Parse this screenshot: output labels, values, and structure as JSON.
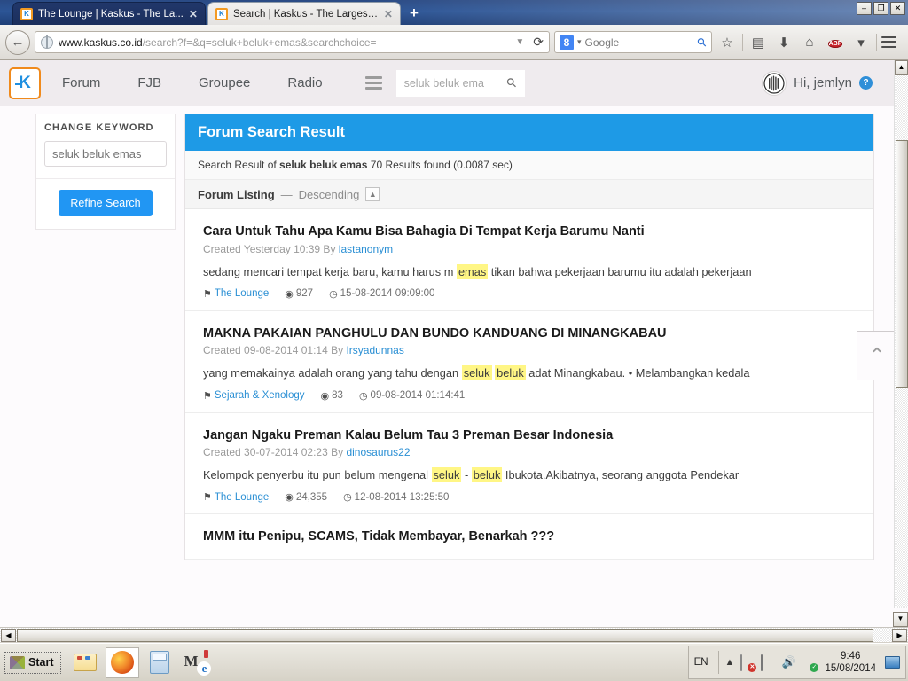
{
  "browser": {
    "tabs": [
      {
        "title": "The Lounge | Kaskus - The La...",
        "active": false,
        "favicon": "kaskus-favicon",
        "close": "✕"
      },
      {
        "title": "Search | Kaskus - The Largest...",
        "active": true,
        "favicon": "kaskus-favicon",
        "close": "✕"
      }
    ],
    "new_tab_label": "+",
    "window_controls": {
      "minimize": "–",
      "restore": "❐",
      "close": "✕"
    },
    "back_arrow": "←",
    "url_strong": "www.kaskus.co.id",
    "url_rest": "/search?f=&q=seluk+beluk+emas&searchchoice=",
    "url_dropdown": "▼",
    "reload": "⟳",
    "search_engine": "Google",
    "search_engine_glyph": "8",
    "search_caret": "▾",
    "search_magnifier": "⚲",
    "toolbar_icons": [
      "bookmark-star-icon",
      "reading-list-icon",
      "downloads-icon",
      "home-icon",
      "adblock-icon",
      "menu-icon"
    ],
    "star": "☆",
    "reading_list": "▤",
    "download": "⬇",
    "home": "⌂",
    "abp_label": "ABP",
    "abp_caret": "▾"
  },
  "site": {
    "logo_letter": "K",
    "nav": [
      {
        "label": "Forum"
      },
      {
        "label": "FJB"
      },
      {
        "label": "Groupee"
      },
      {
        "label": "Radio"
      }
    ],
    "search_placeholder": "seluk beluk ema",
    "search_icon": "⚲",
    "greeting": "Hi, jemlyn",
    "help_badge": "?"
  },
  "sidebar": {
    "title": "CHANGE KEYWORD",
    "keyword_placeholder": "seluk beluk emas",
    "keyword_value": "",
    "refine_label": "Refine Search"
  },
  "panel": {
    "heading": "Forum Search Result",
    "summary_prefix": "Search Result of ",
    "summary_keyword": "seluk beluk emas",
    "summary_suffix": " 70 Results found (0.0087 sec)",
    "listing_label": "Forum Listing",
    "listing_dash": "—",
    "listing_sort": "Descending",
    "sort_toggle": "▲"
  },
  "results": [
    {
      "title": "Cara Untuk Tahu Apa Kamu Bisa Bahagia Di Tempat Kerja Barumu Nanti",
      "created": "Created Yesterday 10:39 By ",
      "author": "lastanonym",
      "snippet_parts": [
        {
          "text": "sedang mencari tempat kerja baru, kamu harus m ",
          "highlight": false
        },
        {
          "text": "emas",
          "highlight": true
        },
        {
          "text": " tikan bahwa pekerjaan barumu itu adalah pekerjaan",
          "highlight": false
        }
      ],
      "forum": "The Lounge",
      "views": "927",
      "timestamp": "15-08-2014 09:09:00"
    },
    {
      "title": "MAKNA PAKAIAN PANGHULU DAN BUNDO KANDUANG DI MINANGKABAU",
      "created": "Created 09-08-2014 01:14 By ",
      "author": "Irsyadunnas",
      "snippet_parts": [
        {
          "text": "yang memakainya adalah orang yang tahu dengan ",
          "highlight": false
        },
        {
          "text": "seluk",
          "highlight": true
        },
        {
          "text": " ",
          "highlight": false
        },
        {
          "text": "beluk",
          "highlight": true
        },
        {
          "text": " adat Minangkabau. • Melambangkan kedala",
          "highlight": false
        }
      ],
      "forum": "Sejarah & Xenology",
      "views": "83",
      "timestamp": "09-08-2014 01:14:41"
    },
    {
      "title": "Jangan Ngaku Preman Kalau Belum Tau 3 Preman Besar Indonesia",
      "created": "Created 30-07-2014 02:23 By ",
      "author": "dinosaurus22",
      "snippet_parts": [
        {
          "text": "Kelompok penyerbu itu pun belum mengenal ",
          "highlight": false
        },
        {
          "text": "seluk",
          "highlight": true
        },
        {
          "text": " - ",
          "highlight": false
        },
        {
          "text": "beluk",
          "highlight": true
        },
        {
          "text": " Ibukota.Akibatnya, seorang anggota Pendekar",
          "highlight": false
        }
      ],
      "forum": "The Lounge",
      "views": "24,355",
      "timestamp": "12-08-2014 13:25:50"
    },
    {
      "title": "MMM itu Penipu, SCAMS, Tidak Membayar, Benarkah ???",
      "partial": true
    }
  ],
  "icons": {
    "tag": "⚑",
    "eye": "◉",
    "clock": "◷",
    "scroll_top": "⌃"
  },
  "taskbar": {
    "start_label": "Start",
    "items": [
      {
        "name": "file-explorer",
        "pressed": false
      },
      {
        "name": "firefox",
        "pressed": true
      },
      {
        "name": "calculator",
        "pressed": false
      },
      {
        "name": "mwe-app",
        "pressed": false
      }
    ],
    "language": "EN",
    "tray_expand": "»",
    "time": "9:46",
    "date": "15/08/2014"
  }
}
